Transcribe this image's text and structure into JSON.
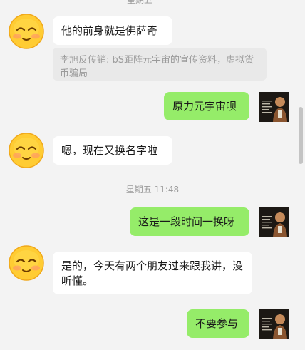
{
  "colors": {
    "background": "#f3f3f3",
    "incoming_bubble": "#ffffff",
    "outgoing_bubble": "#95ec69",
    "quote_bg": "#e9e9e9",
    "meta_text": "#9a9a9a"
  },
  "header_cut": "星期五",
  "icons": {
    "emoji_avatar": "smiling-face-avatar",
    "photo_avatar": "user-photo-avatar"
  },
  "messages": [
    {
      "side": "left",
      "text": "他的前身就是佛萨奇"
    },
    {
      "side": "quote",
      "text": "李旭反传销: bS距阵元宇宙的宣传资料，虚拟货币骗局"
    },
    {
      "side": "right",
      "text": "原力元宇宙呗"
    },
    {
      "side": "left",
      "text": "嗯，现在又换名字啦"
    },
    {
      "side": "time",
      "text": "星期五 11:48"
    },
    {
      "side": "right",
      "text": "这是一段时间一换呀"
    },
    {
      "side": "left",
      "text": "是的，今天有两个朋友过来跟我讲，没听懂。"
    },
    {
      "side": "right",
      "text": "不要参与"
    }
  ]
}
